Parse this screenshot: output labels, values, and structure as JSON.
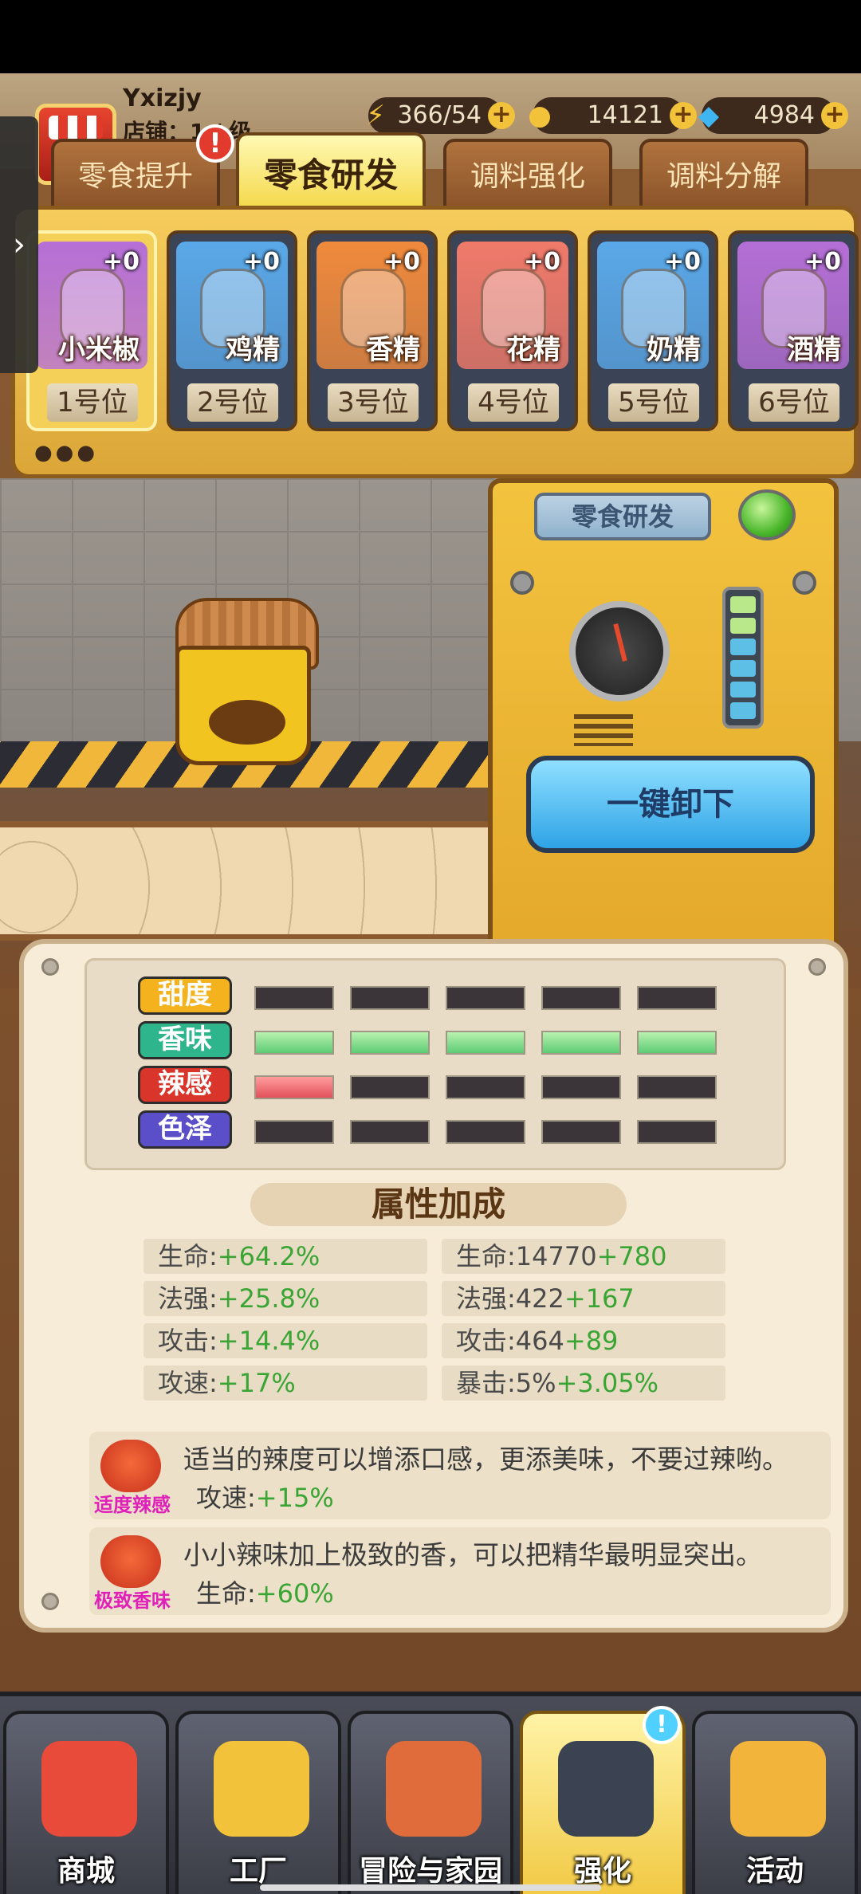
{
  "player": {
    "name": "Yxizjy",
    "shop_label": "店铺：1 / 级"
  },
  "resources": [
    {
      "icon": "lightning-icon",
      "symbol": "⚡",
      "value": "366/54",
      "color": "#f2c23b"
    },
    {
      "icon": "coin-icon",
      "symbol": "●",
      "value": "14121",
      "color": "#f2c23b"
    },
    {
      "icon": "diamond-icon",
      "symbol": "◆",
      "value": "4984",
      "color": "#3fb6f2"
    }
  ],
  "tabs": [
    {
      "label": "零食提升"
    },
    {
      "label": "零食研发",
      "active": true
    },
    {
      "label": "调料强化"
    },
    {
      "label": "调料分解"
    }
  ],
  "tab_alert": "!",
  "side_tab_arrow": "›",
  "slots": [
    {
      "name": "小米椒",
      "position": "1号位",
      "level": "+0",
      "color": "#b56fd6"
    },
    {
      "name": "鸡精",
      "position": "2号位",
      "level": "+0",
      "color": "#5aa8e8"
    },
    {
      "name": "香精",
      "position": "3号位",
      "level": "+0",
      "color": "#f08a3c"
    },
    {
      "name": "花精",
      "position": "4号位",
      "level": "+0",
      "color": "#f07a6a"
    },
    {
      "name": "奶精",
      "position": "5号位",
      "level": "+0",
      "color": "#5aa8e8"
    },
    {
      "name": "酒精",
      "position": "6号位",
      "level": "+0",
      "color": "#b56fd6"
    }
  ],
  "page_dots": "●●●",
  "machine": {
    "sign": "零食研发",
    "unload_button": "一键卸下",
    "meter_level": 0.33
  },
  "attributes": [
    {
      "label": "甜度",
      "color": "#f4b21e",
      "filled": 0,
      "fill_color": "green"
    },
    {
      "label": "香味",
      "color": "#2fb58c",
      "filled": 5,
      "fill_color": "green"
    },
    {
      "label": "辣感",
      "color": "#d9352b",
      "filled": 1,
      "fill_color": "red"
    },
    {
      "label": "色泽",
      "color": "#5a4fc9",
      "filled": 0,
      "fill_color": "green"
    }
  ],
  "bonus_title": "属性加成",
  "bonuses_left": [
    {
      "name": "生命:",
      "value": "+64.2%"
    },
    {
      "name": "法强:",
      "value": "+25.8%"
    },
    {
      "name": "攻击:",
      "value": "+14.4%"
    },
    {
      "name": "攻速:",
      "value": "+17%"
    }
  ],
  "bonuses_right": [
    {
      "name": "生命:14770",
      "value": "+780"
    },
    {
      "name": "法强:422",
      "value": "+167"
    },
    {
      "name": "攻击:464",
      "value": "+89"
    },
    {
      "name": "暴击:5%",
      "value": "+3.05%"
    }
  ],
  "combos": [
    {
      "name": "适度辣感",
      "desc": "适当的辣度可以增添口感，更添美味，不要过辣哟。",
      "stat_name": "攻速:",
      "stat_value": "+15%"
    },
    {
      "name": "极致香味",
      "desc": "小小辣味加上极致的香，可以把精华最明显突出。",
      "stat_name": "生命:",
      "stat_value": "+60%"
    }
  ],
  "nav": [
    {
      "label": "商城",
      "icon": "shop-cart-icon",
      "color": "#e84b3a"
    },
    {
      "label": "工厂",
      "icon": "factory-icon",
      "color": "#f2c23b"
    },
    {
      "label": "冒险与家园",
      "icon": "adventure-icon",
      "color": "#e06b3b"
    },
    {
      "label": "强化",
      "icon": "upgrade-robot-icon",
      "color": "#3b4252",
      "active": true,
      "badge": "!"
    },
    {
      "label": "活动",
      "icon": "megaphone-icon",
      "color": "#f2b43b"
    }
  ]
}
